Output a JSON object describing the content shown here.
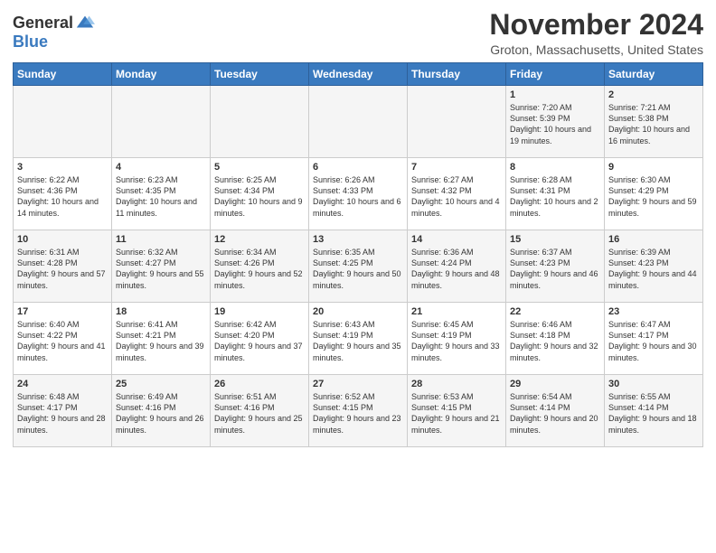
{
  "header": {
    "logo_general": "General",
    "logo_blue": "Blue",
    "month_title": "November 2024",
    "location": "Groton, Massachusetts, United States"
  },
  "days_of_week": [
    "Sunday",
    "Monday",
    "Tuesday",
    "Wednesday",
    "Thursday",
    "Friday",
    "Saturday"
  ],
  "weeks": [
    [
      {
        "day": "",
        "info": ""
      },
      {
        "day": "",
        "info": ""
      },
      {
        "day": "",
        "info": ""
      },
      {
        "day": "",
        "info": ""
      },
      {
        "day": "",
        "info": ""
      },
      {
        "day": "1",
        "info": "Sunrise: 7:20 AM\nSunset: 5:39 PM\nDaylight: 10 hours and 19 minutes."
      },
      {
        "day": "2",
        "info": "Sunrise: 7:21 AM\nSunset: 5:38 PM\nDaylight: 10 hours and 16 minutes."
      }
    ],
    [
      {
        "day": "3",
        "info": "Sunrise: 6:22 AM\nSunset: 4:36 PM\nDaylight: 10 hours and 14 minutes."
      },
      {
        "day": "4",
        "info": "Sunrise: 6:23 AM\nSunset: 4:35 PM\nDaylight: 10 hours and 11 minutes."
      },
      {
        "day": "5",
        "info": "Sunrise: 6:25 AM\nSunset: 4:34 PM\nDaylight: 10 hours and 9 minutes."
      },
      {
        "day": "6",
        "info": "Sunrise: 6:26 AM\nSunset: 4:33 PM\nDaylight: 10 hours and 6 minutes."
      },
      {
        "day": "7",
        "info": "Sunrise: 6:27 AM\nSunset: 4:32 PM\nDaylight: 10 hours and 4 minutes."
      },
      {
        "day": "8",
        "info": "Sunrise: 6:28 AM\nSunset: 4:31 PM\nDaylight: 10 hours and 2 minutes."
      },
      {
        "day": "9",
        "info": "Sunrise: 6:30 AM\nSunset: 4:29 PM\nDaylight: 9 hours and 59 minutes."
      }
    ],
    [
      {
        "day": "10",
        "info": "Sunrise: 6:31 AM\nSunset: 4:28 PM\nDaylight: 9 hours and 57 minutes."
      },
      {
        "day": "11",
        "info": "Sunrise: 6:32 AM\nSunset: 4:27 PM\nDaylight: 9 hours and 55 minutes."
      },
      {
        "day": "12",
        "info": "Sunrise: 6:34 AM\nSunset: 4:26 PM\nDaylight: 9 hours and 52 minutes."
      },
      {
        "day": "13",
        "info": "Sunrise: 6:35 AM\nSunset: 4:25 PM\nDaylight: 9 hours and 50 minutes."
      },
      {
        "day": "14",
        "info": "Sunrise: 6:36 AM\nSunset: 4:24 PM\nDaylight: 9 hours and 48 minutes."
      },
      {
        "day": "15",
        "info": "Sunrise: 6:37 AM\nSunset: 4:23 PM\nDaylight: 9 hours and 46 minutes."
      },
      {
        "day": "16",
        "info": "Sunrise: 6:39 AM\nSunset: 4:23 PM\nDaylight: 9 hours and 44 minutes."
      }
    ],
    [
      {
        "day": "17",
        "info": "Sunrise: 6:40 AM\nSunset: 4:22 PM\nDaylight: 9 hours and 41 minutes."
      },
      {
        "day": "18",
        "info": "Sunrise: 6:41 AM\nSunset: 4:21 PM\nDaylight: 9 hours and 39 minutes."
      },
      {
        "day": "19",
        "info": "Sunrise: 6:42 AM\nSunset: 4:20 PM\nDaylight: 9 hours and 37 minutes."
      },
      {
        "day": "20",
        "info": "Sunrise: 6:43 AM\nSunset: 4:19 PM\nDaylight: 9 hours and 35 minutes."
      },
      {
        "day": "21",
        "info": "Sunrise: 6:45 AM\nSunset: 4:19 PM\nDaylight: 9 hours and 33 minutes."
      },
      {
        "day": "22",
        "info": "Sunrise: 6:46 AM\nSunset: 4:18 PM\nDaylight: 9 hours and 32 minutes."
      },
      {
        "day": "23",
        "info": "Sunrise: 6:47 AM\nSunset: 4:17 PM\nDaylight: 9 hours and 30 minutes."
      }
    ],
    [
      {
        "day": "24",
        "info": "Sunrise: 6:48 AM\nSunset: 4:17 PM\nDaylight: 9 hours and 28 minutes."
      },
      {
        "day": "25",
        "info": "Sunrise: 6:49 AM\nSunset: 4:16 PM\nDaylight: 9 hours and 26 minutes."
      },
      {
        "day": "26",
        "info": "Sunrise: 6:51 AM\nSunset: 4:16 PM\nDaylight: 9 hours and 25 minutes."
      },
      {
        "day": "27",
        "info": "Sunrise: 6:52 AM\nSunset: 4:15 PM\nDaylight: 9 hours and 23 minutes."
      },
      {
        "day": "28",
        "info": "Sunrise: 6:53 AM\nSunset: 4:15 PM\nDaylight: 9 hours and 21 minutes."
      },
      {
        "day": "29",
        "info": "Sunrise: 6:54 AM\nSunset: 4:14 PM\nDaylight: 9 hours and 20 minutes."
      },
      {
        "day": "30",
        "info": "Sunrise: 6:55 AM\nSunset: 4:14 PM\nDaylight: 9 hours and 18 minutes."
      }
    ]
  ]
}
